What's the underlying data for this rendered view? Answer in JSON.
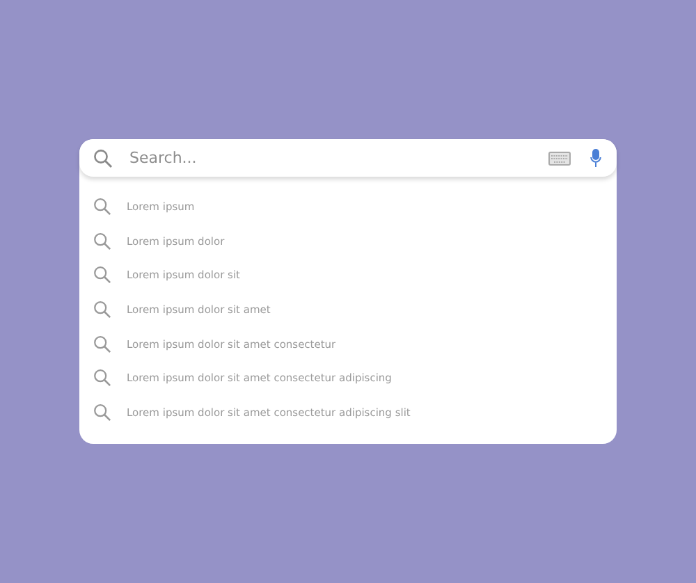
{
  "search": {
    "placeholder": "Search..."
  },
  "suggestions": [
    {
      "text": "Lorem ipsum"
    },
    {
      "text": "Lorem ipsum dolor"
    },
    {
      "text": "Lorem ipsum dolor sit"
    },
    {
      "text": "Lorem ipsum dolor sit amet"
    },
    {
      "text": "Lorem ipsum dolor sit amet consectetur"
    },
    {
      "text": "Lorem ipsum dolor sit amet consectetur adipiscing"
    },
    {
      "text": "Lorem ipsum dolor sit amet consectetur adipiscing slit"
    }
  ]
}
